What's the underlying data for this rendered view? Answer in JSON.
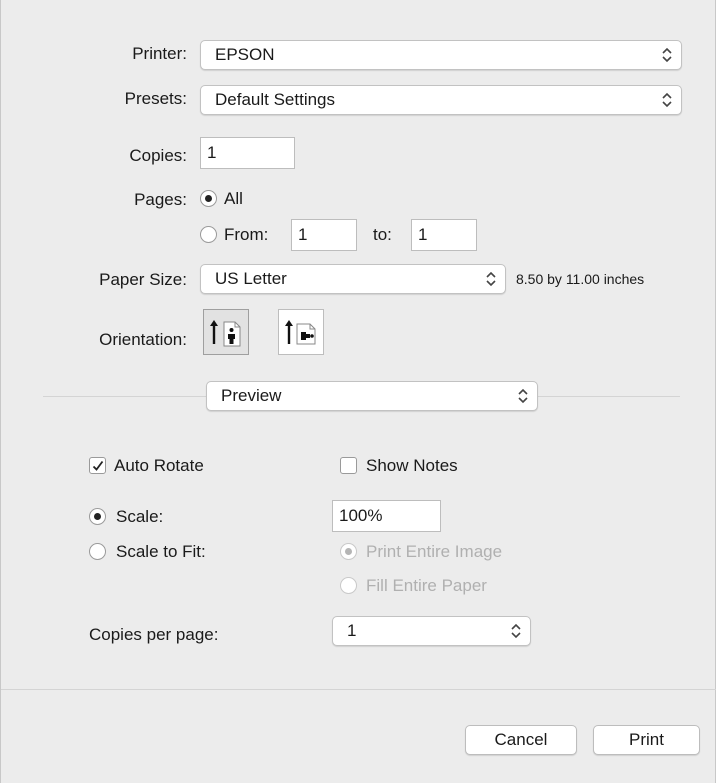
{
  "printer": {
    "label": "Printer:",
    "value": "EPSON"
  },
  "presets": {
    "label": "Presets:",
    "value": "Default Settings"
  },
  "copies": {
    "label": "Copies:",
    "value": "1"
  },
  "pages": {
    "label": "Pages:",
    "all_label": "All",
    "from_label": "From:",
    "from_value": "1",
    "to_label": "to:",
    "to_value": "1",
    "selected": "All"
  },
  "paper_size": {
    "label": "Paper Size:",
    "value": "US Letter",
    "dimensions": "8.50 by 11.00 inches"
  },
  "orientation": {
    "label": "Orientation:",
    "options": [
      "portrait",
      "landscape"
    ],
    "selected": "portrait"
  },
  "section": {
    "value": "Preview"
  },
  "preview": {
    "auto_rotate": {
      "label": "Auto Rotate",
      "checked": true
    },
    "show_notes": {
      "label": "Show Notes",
      "checked": false
    },
    "scale": {
      "label": "Scale:",
      "value": "100%",
      "selected": true
    },
    "scale_to_fit": {
      "label": "Scale to Fit:",
      "print_entire_image": "Print Entire Image",
      "fill_entire_paper": "Fill Entire Paper",
      "selected_option": "Print Entire Image"
    },
    "copies_per_page": {
      "label": "Copies per page:",
      "value": "1"
    }
  },
  "buttons": {
    "cancel": "Cancel",
    "print": "Print"
  }
}
